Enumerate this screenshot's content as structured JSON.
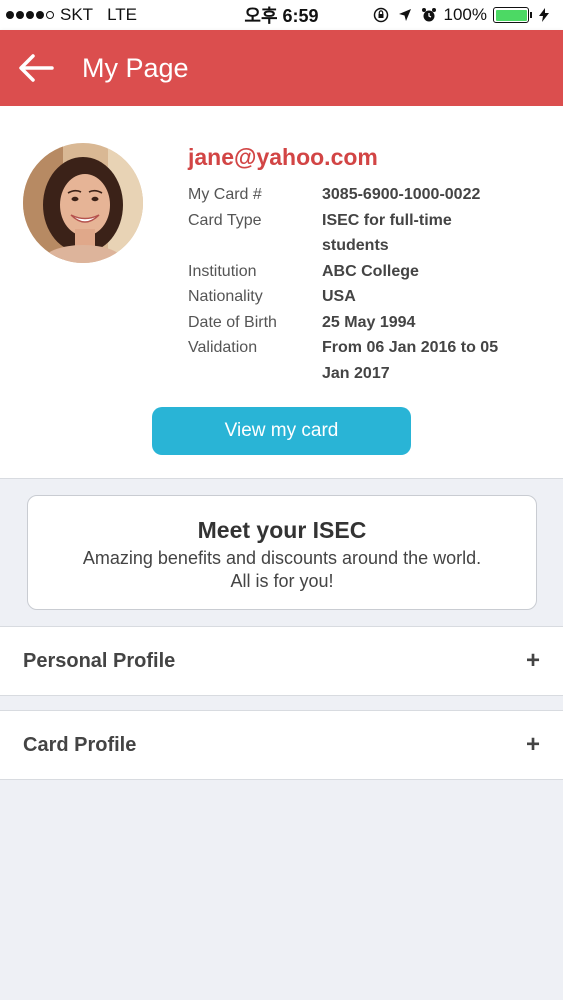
{
  "status_bar": {
    "carrier": "SKT",
    "network": "LTE",
    "time": "오후 6:59",
    "battery": "100%",
    "battery_level": 1.0
  },
  "header": {
    "title": "My Page",
    "accent_color": "#db4e4e"
  },
  "profile": {
    "email": "jane@yahoo.com",
    "fields": [
      {
        "label": "My Card #",
        "value": "3085-6900-1000-0022"
      },
      {
        "label": "Card Type",
        "value": "ISEC for full-time students"
      },
      {
        "label": "Institution",
        "value": "ABC College"
      },
      {
        "label": "Nationality",
        "value": "USA"
      },
      {
        "label": "Date of Birth",
        "value": "25 May 1994"
      },
      {
        "label": "Validation",
        "value": "From 06 Jan 2016 to 05 Jan 2017"
      }
    ],
    "view_card_label": "View my card",
    "button_color": "#29b4d6"
  },
  "promo": {
    "title": "Meet your ISEC",
    "line1": "Amazing benefits and discounts around the world.",
    "line2": "All is for you!"
  },
  "sections": [
    {
      "label": "Personal Profile",
      "icon": "+"
    },
    {
      "label": "Card Profile",
      "icon": "+"
    }
  ]
}
